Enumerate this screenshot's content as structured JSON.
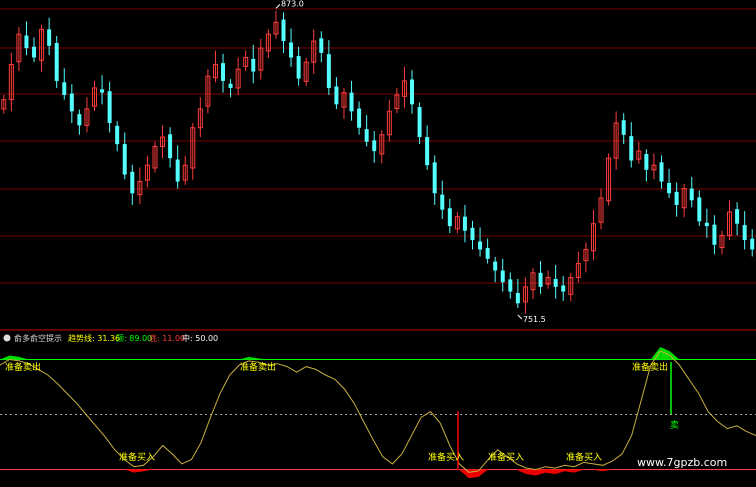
{
  "chart_data": [
    {
      "type": "candlestick",
      "title": "",
      "annotations": {
        "high_label": "873.0",
        "low_label": "751.5"
      },
      "ylim": [
        745,
        880
      ],
      "colors": {
        "up": "#ff3c3c",
        "down": "#54ffff",
        "grid": "#7a0000"
      },
      "closes": [
        840,
        855,
        868,
        862,
        858,
        870,
        863,
        848,
        842,
        835,
        829,
        836,
        845,
        843,
        830,
        821,
        808,
        800,
        805,
        812,
        820,
        824,
        815,
        805,
        812,
        828,
        836,
        850,
        855,
        848,
        845,
        853,
        858,
        852,
        862,
        868,
        873,
        865,
        858,
        849,
        856,
        865,
        860,
        845,
        838,
        843,
        835,
        828,
        822,
        818,
        825,
        835,
        842,
        848,
        838,
        824,
        812,
        800,
        793,
        786,
        790,
        784,
        780,
        776,
        772,
        767,
        762,
        758,
        753,
        760,
        766,
        760,
        764,
        760,
        758,
        764,
        770,
        776,
        787,
        798,
        815,
        830,
        825,
        814,
        818,
        810,
        812,
        805,
        800,
        795,
        802,
        797,
        788,
        786,
        778,
        782,
        792,
        787,
        780,
        776
      ]
    },
    {
      "type": "line",
      "title": "",
      "indicator_name": "俞多俞空提示",
      "legend": [
        {
          "label": "趋势线: 31.36",
          "color": "#ffff00"
        },
        {
          "label": "顶: 89.00",
          "color": "#00ff00"
        },
        {
          "label": "底: 11.00",
          "color": "#ff3c3c"
        },
        {
          "label": "中: 50.00",
          "color": "#ffffff"
        }
      ],
      "ylim": [
        0,
        100
      ],
      "reference_lines": [
        {
          "name": "顶",
          "value": 89,
          "color": "#00ff00",
          "style": "solid"
        },
        {
          "name": "中",
          "value": 50,
          "color": "#aaaaaa",
          "style": "dotted"
        },
        {
          "name": "底",
          "value": 11,
          "color": "#ff3c3c",
          "style": "solid"
        }
      ],
      "series": [
        {
          "values": [
            85,
            89,
            88,
            86,
            82,
            78,
            72,
            65,
            58,
            50,
            42,
            34,
            25,
            18,
            13,
            14,
            20,
            28,
            22,
            15,
            18,
            30,
            48,
            65,
            78,
            85,
            88,
            87,
            85,
            86,
            84,
            80,
            84,
            82,
            78,
            75,
            68,
            58,
            45,
            32,
            20,
            15,
            22,
            35,
            48,
            52,
            44,
            28,
            15,
            9,
            10,
            18,
            25,
            20,
            15,
            12,
            11,
            13,
            12,
            14,
            13,
            16,
            15,
            14,
            17,
            22,
            35,
            60,
            85,
            95,
            92,
            85,
            75,
            65,
            52,
            45,
            40,
            42,
            38,
            35
          ]
        }
      ],
      "signals": [
        {
          "text": "准备卖出",
          "color": "#ffff00"
        },
        {
          "text": "准备卖出",
          "color": "#ffff00"
        },
        {
          "text": "准备卖出",
          "color": "#ffff00"
        },
        {
          "text": "准备买入",
          "color": "#ffff00"
        },
        {
          "text": "准备买入",
          "color": "#ffff00"
        },
        {
          "text": "准备买入",
          "color": "#ffff00"
        },
        {
          "text": "准备买入",
          "color": "#ffff00"
        },
        {
          "text": "卖",
          "color": "#00ff00"
        }
      ]
    }
  ],
  "watermark": "www.7gpzb.com"
}
